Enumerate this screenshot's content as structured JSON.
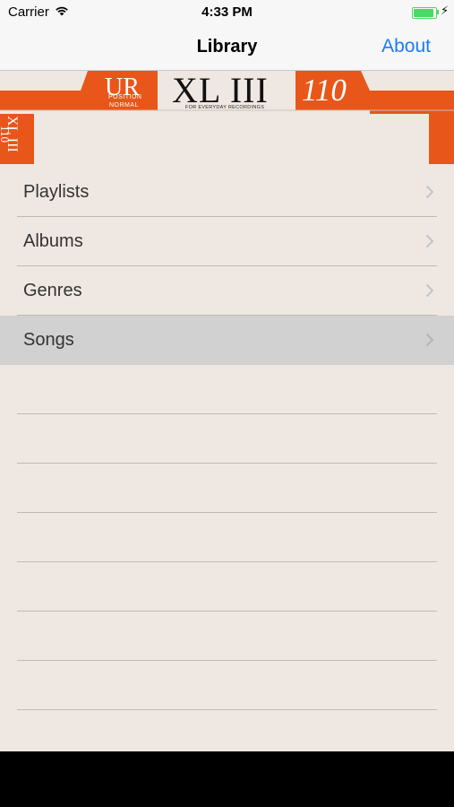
{
  "status_bar": {
    "carrier": "Carrier",
    "time": "4:33 PM",
    "battery_level": 1.0,
    "wifi_icon": "wifi-icon",
    "charging_icon": "bolt-icon"
  },
  "nav": {
    "title": "Library",
    "right_button": "About"
  },
  "cassette": {
    "ur": "UR",
    "ur_sub1": "POSITION",
    "ur_sub2": "NORMAL",
    "brand": "XL III",
    "tagline": "FOR EVERYDAY RECORDINGS",
    "number": "110",
    "side_label": "XL III",
    "side_number": "110",
    "accent_color": "#e8561a"
  },
  "library": {
    "items": [
      {
        "label": "Playlists"
      },
      {
        "label": "Albums"
      },
      {
        "label": "Genres"
      },
      {
        "label": "Songs"
      }
    ],
    "selected_index": 3
  },
  "colors": {
    "background": "#efe8e2",
    "accent": "#1a7cf5",
    "selected_row": "#d1d1d1"
  }
}
